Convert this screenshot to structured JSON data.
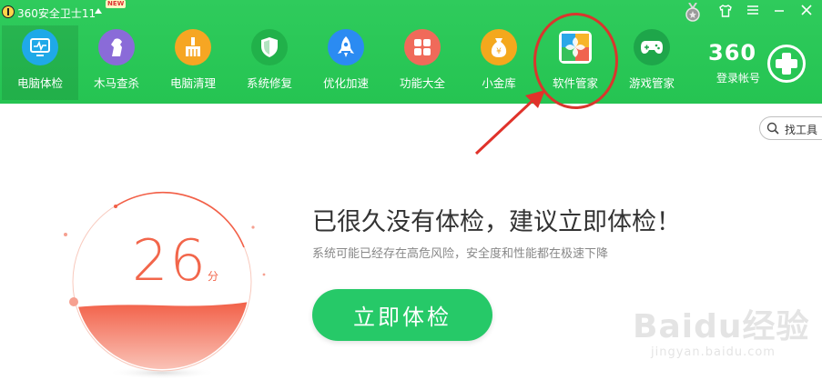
{
  "titlebar": {
    "app_title": "360安全卫士11",
    "new_badge": "NEW"
  },
  "nav": {
    "items": [
      {
        "label": "电脑体检",
        "icon": "monitor-icon",
        "color": "#1fa9e8",
        "active": true
      },
      {
        "label": "木马查杀",
        "icon": "horse-icon",
        "color": "#8a6bd8"
      },
      {
        "label": "电脑清理",
        "icon": "broom-icon",
        "color": "#f6a623"
      },
      {
        "label": "系统修复",
        "icon": "shield-icon",
        "color": "#21b14a"
      },
      {
        "label": "优化加速",
        "icon": "rocket-icon",
        "color": "#2b8bf2"
      },
      {
        "label": "功能大全",
        "icon": "grid-icon",
        "color": "#f06a5a"
      },
      {
        "label": "小金库",
        "icon": "moneybag-icon",
        "color": "#f4a81d"
      },
      {
        "label": "软件管家",
        "icon": "software-icon",
        "color": "#ffffff"
      },
      {
        "label": "游戏管家",
        "icon": "gamepad-icon",
        "color": "#1ea64a"
      }
    ]
  },
  "account": {
    "brand": "360",
    "login_label": "登录帐号"
  },
  "tools": {
    "search_label": "找工具"
  },
  "score": {
    "value": "26",
    "unit": "分"
  },
  "main": {
    "headline": "已很久没有体检，建议立即体检！",
    "subtext": "系统可能已经存在高危风险，安全度和性能都在极速下降",
    "check_button": "立即体检"
  },
  "watermark": {
    "brand": "Baidu经验",
    "url": "jingyan.baidu.com"
  },
  "colors": {
    "header_green": "#27c555",
    "accent_green": "#26c968",
    "score_red": "#f2664b",
    "annotation_red": "#d9362d"
  }
}
